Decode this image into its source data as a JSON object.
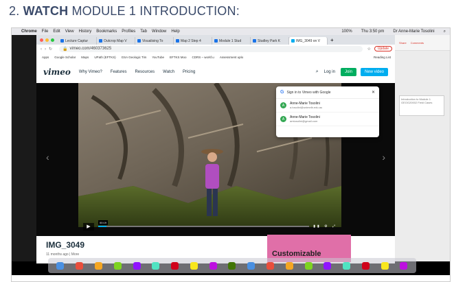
{
  "heading": {
    "number": "2.",
    "bold": "WATCH",
    "rest": "MODULE 1 INTRODUCTION:"
  },
  "menubar": {
    "items": [
      "Chrome",
      "File",
      "Edit",
      "View",
      "History",
      "Bookmarks",
      "Profiles",
      "Tab",
      "Window",
      "Help"
    ],
    "clock": "Thu 3:50 pm",
    "user": "Dr Anne-Marie Tosolini",
    "battery": "100%"
  },
  "browser": {
    "tabs": [
      "Lecture Captur",
      "Outcrop Map V",
      "Visualising To",
      "Map 2 Step 4",
      "Module 1 Stud",
      "Studley Park K",
      "IMG_3049 on V"
    ],
    "url": "vimeo.com/460373625",
    "update_label": "Update",
    "bookmarks": [
      "Apps",
      "Google Scholar",
      "Maps",
      "UPath (EFTKS)",
      "GSA Geologic Tim",
      "YouTube",
      "EFTKS Moo",
      "CDRS – workf.u",
      "Assessment uplo",
      "Reading List"
    ]
  },
  "vimeo": {
    "logo": "vimeo",
    "nav": [
      "Why Vimeo?",
      "Features",
      "Resources",
      "Watch",
      "Pricing"
    ],
    "login": "Log in",
    "join": "Join",
    "new_video": "New video",
    "video_title": "IMG_3049",
    "video_meta": "11 months ago  |  More",
    "timecode": "00:19",
    "progress": 0.04,
    "ad_text": "Customizable"
  },
  "google_popup": {
    "title": "Sign in to Vimeo with Google",
    "accounts": [
      {
        "initial": "A",
        "name": "Anne-Marie Tosolini",
        "email": "a.tosolini@unimelb.edu.au"
      },
      {
        "initial": "A",
        "name": "Anne-Marie Tosolini",
        "email": "amtosolini@gmail.com"
      }
    ]
  },
  "side_panel": {
    "share_label": "Share",
    "comments_label": "Comments",
    "doc_text": "Introduction to Module 1 GEOG20002 Field Cases"
  },
  "colors": {
    "join": "#00ad5f",
    "new_video": "#00adef",
    "ad": "#e06fa8",
    "heading": "#3a4a6a"
  },
  "dock_icons": [
    "finder-icon",
    "launchpad-icon",
    "safari-icon",
    "chrome-icon",
    "maps-icon",
    "photos-icon",
    "calendar-icon",
    "notes-icon",
    "reminders-icon",
    "music-icon",
    "podcasts-icon",
    "tv-icon",
    "app-store-icon",
    "settings-icon",
    "word-icon",
    "powerpoint-icon",
    "acrobat-icon",
    "zoom-icon",
    "trash-icon"
  ]
}
